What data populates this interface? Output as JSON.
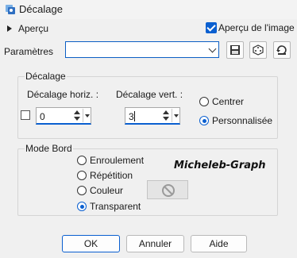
{
  "window": {
    "title": "Décalage"
  },
  "preview": {
    "label": "Aperçu",
    "image_checkbox_label": "Aperçu de l'image",
    "image_checked": true
  },
  "parameters": {
    "label": "Paramètres",
    "value": ""
  },
  "offset_group": {
    "title": "Décalage",
    "horiz_label": "Décalage horiz. :",
    "horiz_value": "0",
    "vert_label": "Décalage vert. :",
    "vert_value": "3",
    "options": [
      {
        "label": "Centrer",
        "selected": false
      },
      {
        "label": "Personnalisée",
        "selected": true
      }
    ]
  },
  "edge_group": {
    "title": "Mode Bord",
    "options": [
      {
        "label": "Enroulement",
        "selected": false
      },
      {
        "label": "Répétition",
        "selected": false
      },
      {
        "label": "Couleur",
        "selected": false
      },
      {
        "label": "Transparent",
        "selected": true
      }
    ],
    "watermark": "Micheleb-Graph"
  },
  "buttons": {
    "ok": "OK",
    "cancel": "Annuler",
    "help": "Aide"
  },
  "colors": {
    "accent": "#0a5fd0"
  }
}
